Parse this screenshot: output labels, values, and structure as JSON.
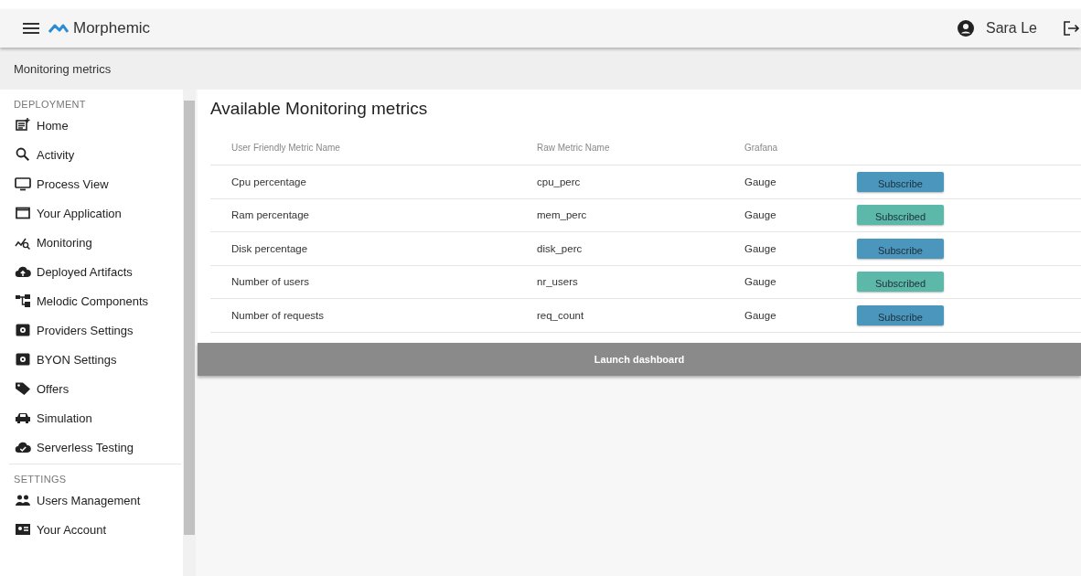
{
  "header": {
    "app_name": "Morphemic",
    "user_name": "Sara Le"
  },
  "breadcrumb": "Monitoring metrics",
  "sidebar": {
    "sections": [
      {
        "title": "DEPLOYMENT",
        "items": [
          {
            "label": "Home"
          },
          {
            "label": "Activity"
          },
          {
            "label": "Process View"
          },
          {
            "label": "Your Application"
          },
          {
            "label": "Monitoring"
          },
          {
            "label": "Deployed Artifacts"
          },
          {
            "label": "Melodic Components"
          },
          {
            "label": "Providers Settings"
          },
          {
            "label": "BYON Settings"
          },
          {
            "label": "Offers"
          },
          {
            "label": "Simulation"
          },
          {
            "label": "Serverless Testing"
          }
        ]
      },
      {
        "title": "SETTINGS",
        "items": [
          {
            "label": "Users Management"
          },
          {
            "label": "Your Account"
          }
        ]
      }
    ]
  },
  "panel": {
    "title": "Available Monitoring metrics",
    "table": {
      "columns": [
        "User Friendly Metric Name",
        "Raw Metric Name",
        "Grafana"
      ],
      "rows": [
        {
          "name": "Cpu percentage",
          "raw": "cpu_perc",
          "grafana": "Gauge",
          "button": "Subscribe",
          "subscribed": false
        },
        {
          "name": "Ram percentage",
          "raw": "mem_perc",
          "grafana": "Gauge",
          "button": "Subscribed",
          "subscribed": true
        },
        {
          "name": "Disk percentage",
          "raw": "disk_perc",
          "grafana": "Gauge",
          "button": "Subscribe",
          "subscribed": false
        },
        {
          "name": "Number of users",
          "raw": "nr_users",
          "grafana": "Gauge",
          "button": "Subscribed",
          "subscribed": true
        },
        {
          "name": "Number of requests",
          "raw": "req_count",
          "grafana": "Gauge",
          "button": "Subscribe",
          "subscribed": false
        }
      ]
    },
    "launch_button": "Launch dashboard"
  }
}
